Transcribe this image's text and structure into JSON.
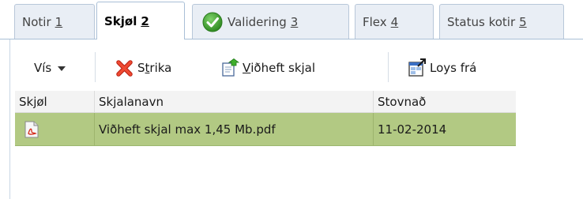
{
  "tabs": [
    {
      "label": "Notir",
      "key": "1",
      "icon": null,
      "active": false
    },
    {
      "label": "Skjøl",
      "key": "2",
      "icon": null,
      "active": true
    },
    {
      "label": "Validering",
      "key": "3",
      "icon": "green-check-icon",
      "active": false
    },
    {
      "label": "Flex",
      "key": "4",
      "icon": null,
      "active": false
    },
    {
      "label": "Status kotir",
      "key": "5",
      "icon": null,
      "active": false
    }
  ],
  "toolbar": {
    "view_label": "Vís",
    "delete_pre": "S",
    "delete_u": "t",
    "delete_post": "rika",
    "attach_pre": "",
    "attach_u": "V",
    "attach_post": "iðheft skjal",
    "detach_label": "Loys frá"
  },
  "grid": {
    "columns": [
      "Skjøl",
      "Skjalanavn",
      "Stovnað"
    ],
    "rows": [
      {
        "icon": "pdf-icon",
        "name": "Viðheft skjal max 1,45 Mb.pdf",
        "created": "11-02-2014",
        "selected": true
      }
    ]
  },
  "colors": {
    "selected_row": "#b2c983",
    "tab_border": "#a9bfd6",
    "delete_icon": "#e0301e",
    "check_icon": "#3a9a2a"
  }
}
